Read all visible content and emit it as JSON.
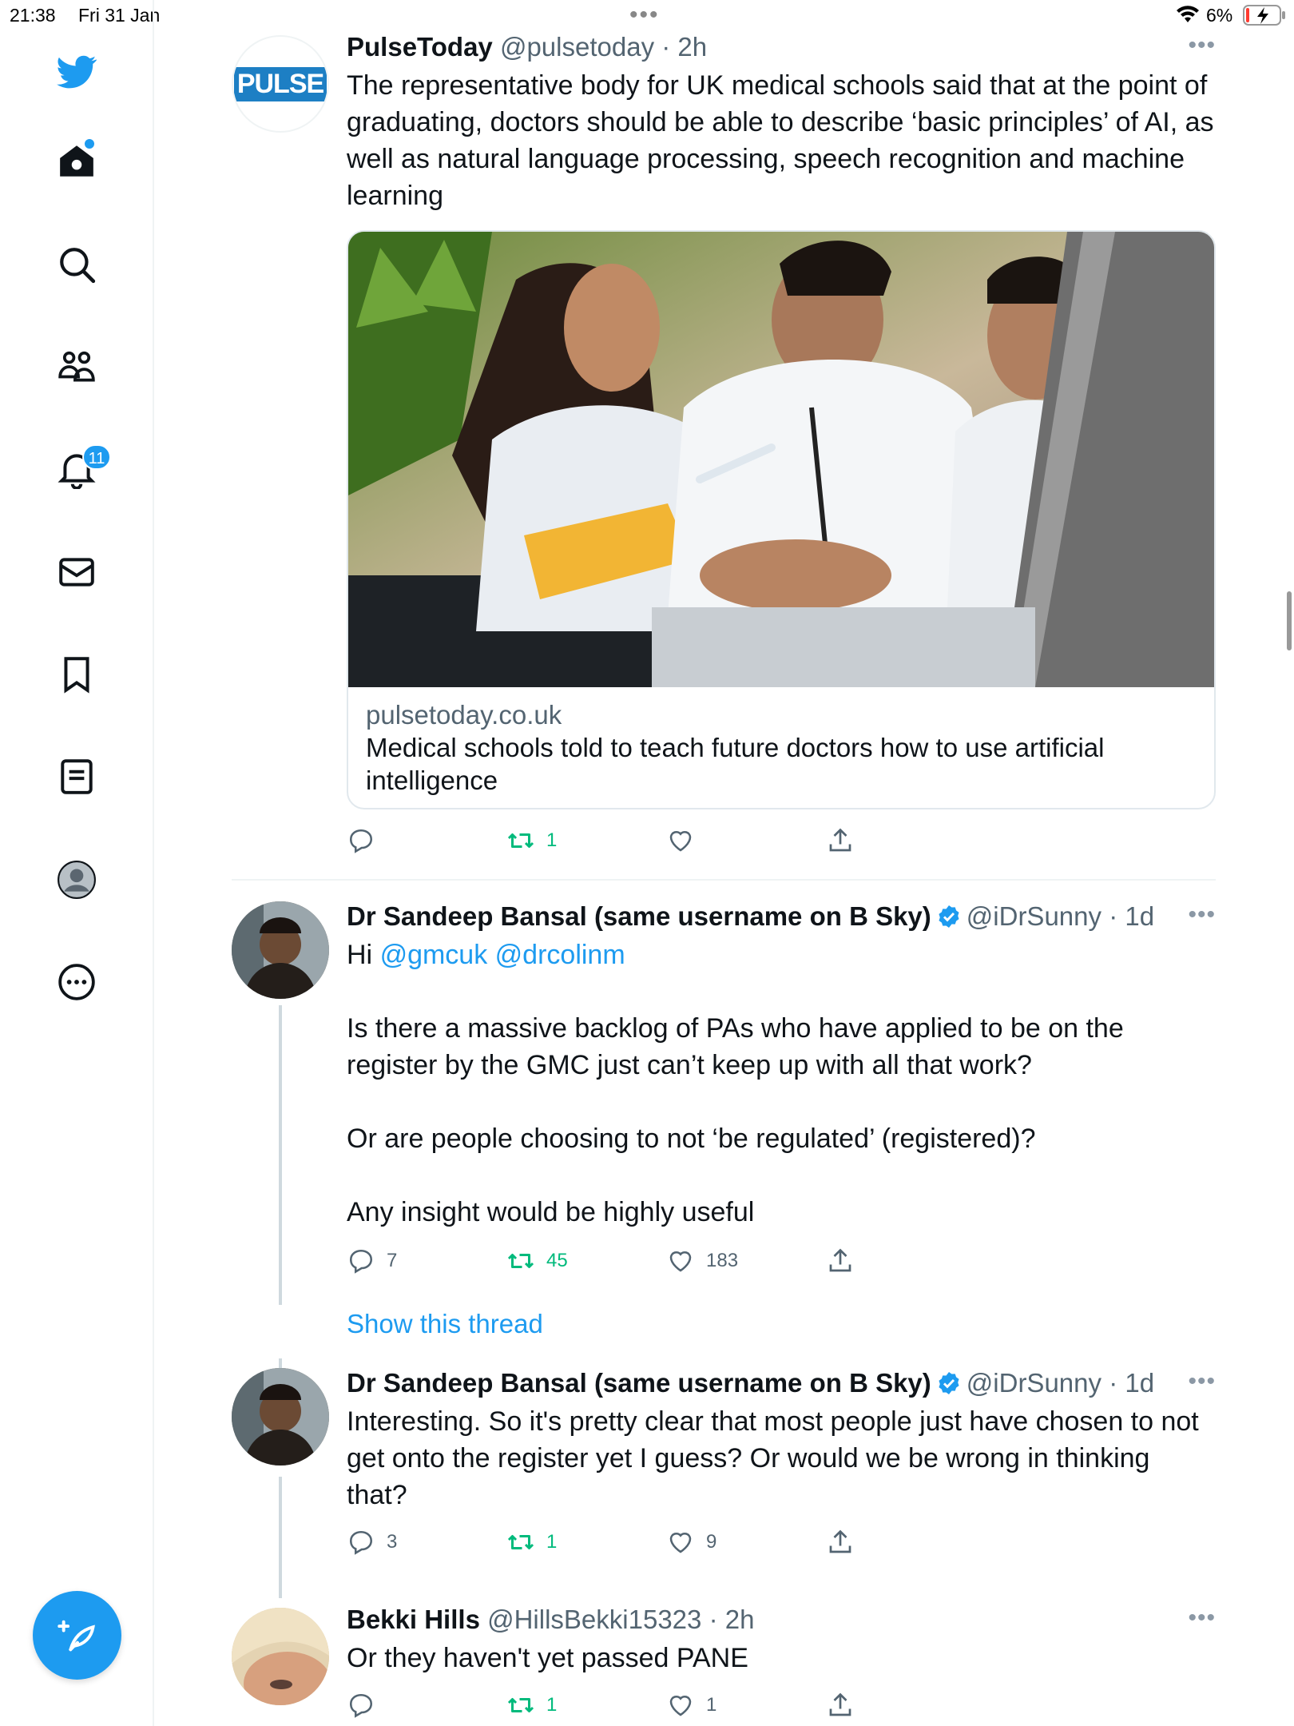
{
  "status_bar": {
    "time": "21:38",
    "date": "Fri 31 Jan",
    "battery": "6%",
    "icons": [
      "wifi-icon",
      "battery-charging-icon"
    ]
  },
  "sidebar": {
    "items": [
      "twitter-logo-icon",
      "home-icon",
      "search-icon",
      "communities-icon",
      "notifications-icon",
      "messages-icon",
      "bookmarks-icon",
      "lists-icon",
      "profile-icon",
      "more-icon"
    ],
    "notification_count": "11"
  },
  "tweets": [
    {
      "name": "PulseToday",
      "handle": "@pulsetoday",
      "time": "· 2h",
      "avatar_text": "PULSE",
      "text": [
        "The representative body for UK medical schools said that at the point of graduating, doctors should be able to describe ‘basic principles’ of AI, as well as natural language processing, speech recognition and machine learning"
      ],
      "card": {
        "domain": "pulsetoday.co.uk",
        "title": "Medical schools told to teach future doctors how to use artificial intelligence"
      },
      "replies": "",
      "retweets": "1",
      "likes": ""
    },
    {
      "name": "Dr Sandeep Bansal (same username on B Sky)",
      "handle": "@iDrSunny",
      "time": "· 1d",
      "text_intro": "Hi",
      "mentions": "@gmcuk @drcolinm",
      "text": [
        "Is there a massive backlog of PAs who have applied to be on the register by the GMC just can’t keep up with all that work?",
        "Or are people choosing to not ‘be regulated’ (registered)?",
        "Any insight would be highly useful"
      ],
      "replies": "7",
      "retweets": "45",
      "likes": "183",
      "show_thread": "Show this thread"
    },
    {
      "name": "Dr Sandeep Bansal (same username on B Sky)",
      "handle": "@iDrSunny",
      "time": "· 1d",
      "text": [
        "Interesting. So it's pretty clear that most people just have chosen to not get onto the register yet I guess? Or would we be wrong in thinking that?"
      ],
      "replies": "3",
      "retweets": "1",
      "likes": "9"
    },
    {
      "name": "Bekki Hills",
      "handle": "@HillsBekki15323",
      "time": "· 2h",
      "text": [
        "Or they haven't yet passed PANE"
      ],
      "replies": "",
      "retweets": "1",
      "likes": "1"
    }
  ],
  "colors": {
    "accent": "#1d9bf0",
    "retweet": "#00ba7c",
    "muted": "#536471"
  }
}
